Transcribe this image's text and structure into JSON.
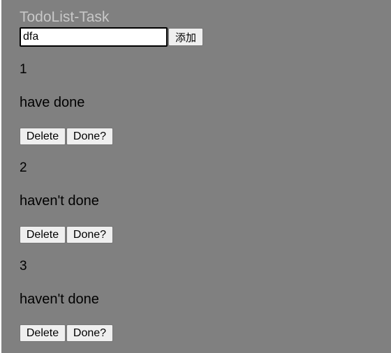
{
  "app": {
    "title": "TodoList-Task"
  },
  "add_form": {
    "input_value": "dfa",
    "add_label": "添加"
  },
  "tasks": [
    {
      "id": "1",
      "status": "have done",
      "delete_label": "Delete",
      "done_label": "Done?"
    },
    {
      "id": "2",
      "status": "haven't done",
      "delete_label": "Delete",
      "done_label": "Done?"
    },
    {
      "id": "3",
      "status": "haven't done",
      "delete_label": "Delete",
      "done_label": "Done?"
    }
  ]
}
